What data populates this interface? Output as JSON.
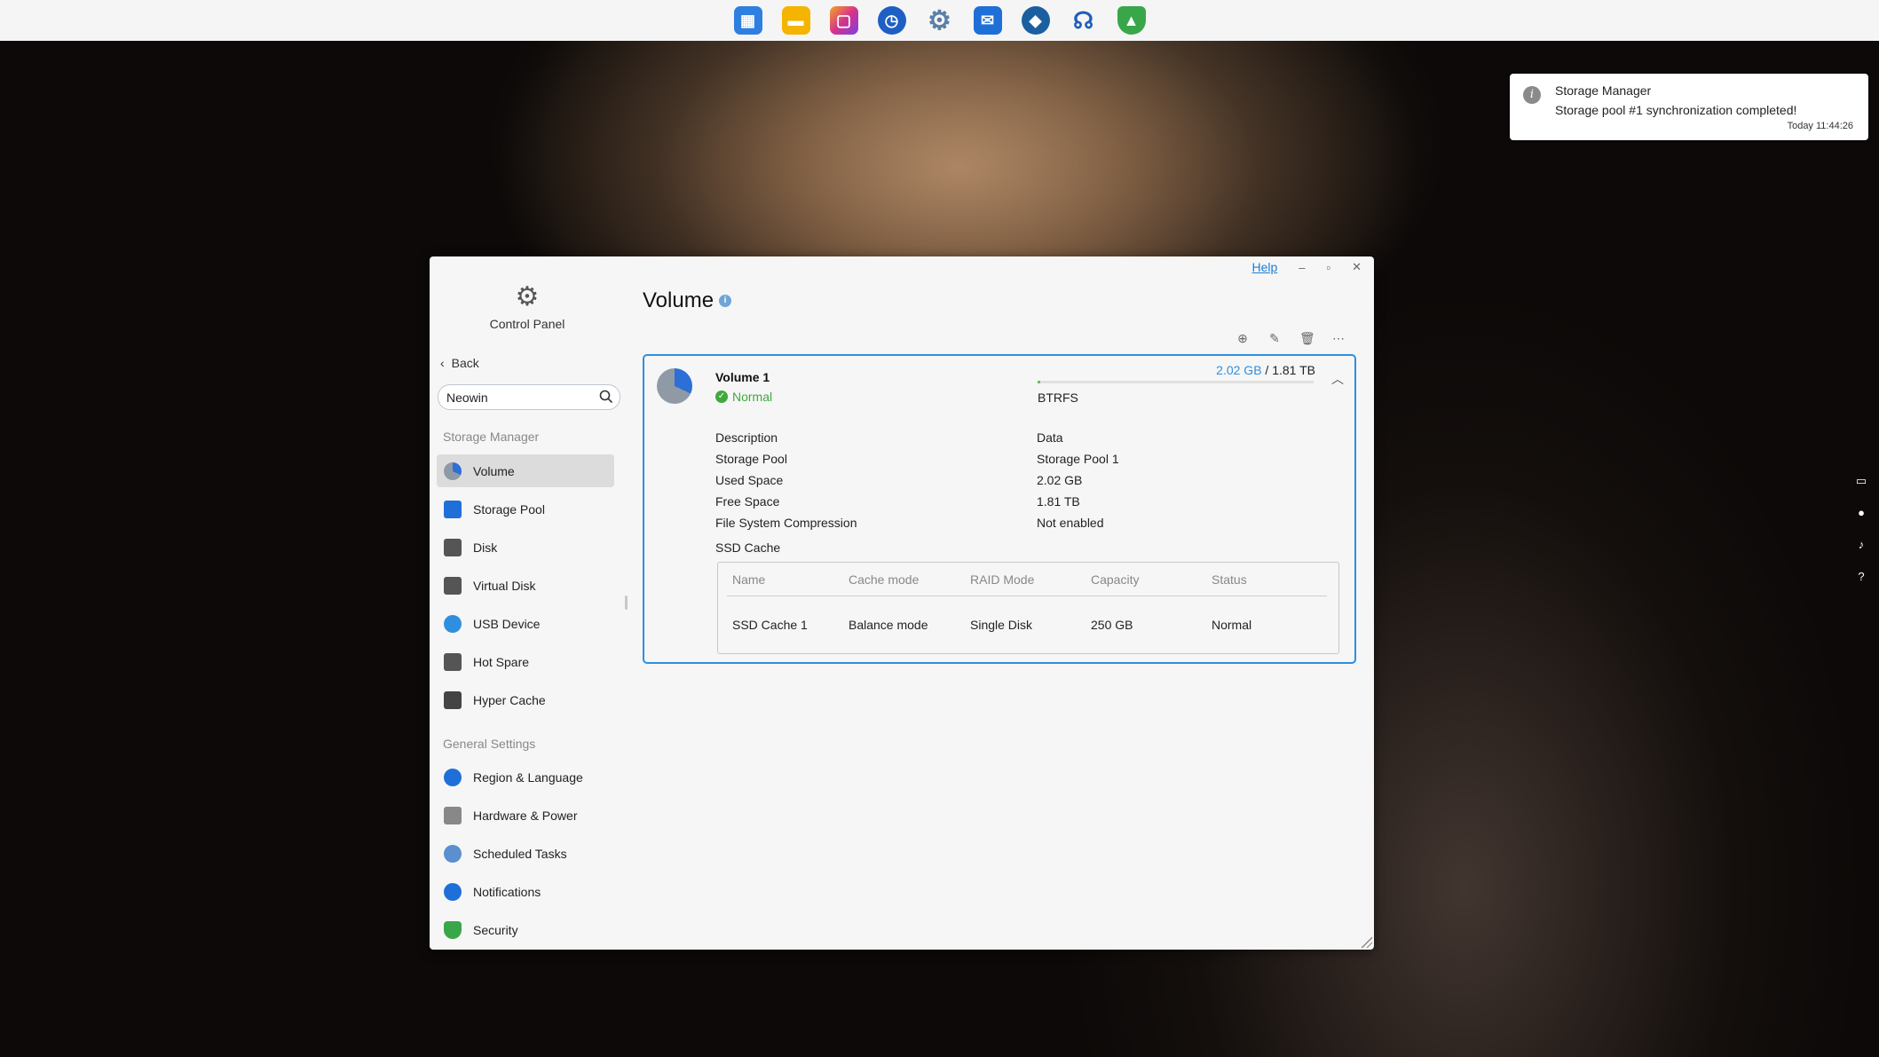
{
  "taskbar": {
    "icons": [
      {
        "name": "apps-grid-icon",
        "color": "#2f7fe0"
      },
      {
        "name": "folder-icon",
        "color": "#f4b400"
      },
      {
        "name": "photos-icon",
        "color": "#d6338a"
      },
      {
        "name": "backup-clock-icon",
        "color": "#1e5fc4"
      },
      {
        "name": "settings-gear-icon",
        "color": "#5a7fa8"
      },
      {
        "name": "mail-icon",
        "color": "#1f6fd8"
      },
      {
        "name": "docker-icon",
        "color": "#1b5fa0"
      },
      {
        "name": "support-headset-icon",
        "color": "#1f5fb8"
      },
      {
        "name": "security-shield-icon",
        "color": "#3aa64a"
      }
    ]
  },
  "toast": {
    "app": "Storage Manager",
    "message": "Storage pool #1 synchronization completed!",
    "time": "Today 11:44:26"
  },
  "window": {
    "help_label": "Help",
    "minimize": "–",
    "maximize": "▫",
    "close": "✕"
  },
  "sidebar": {
    "app_label": "Control Panel",
    "back_label": "Back",
    "search_value": "Neowin",
    "storage_section": "Storage Manager",
    "storage_items": [
      {
        "label": "Volume",
        "color": "#2c6fd6"
      },
      {
        "label": "Storage Pool",
        "color": "#1f6fd8"
      },
      {
        "label": "Disk",
        "color": "#555"
      },
      {
        "label": "Virtual Disk",
        "color": "#555"
      },
      {
        "label": "USB Device",
        "color": "#2f8fde"
      },
      {
        "label": "Hot Spare",
        "color": "#555"
      },
      {
        "label": "Hyper Cache",
        "color": "#444"
      }
    ],
    "general_section": "General Settings",
    "general_items": [
      {
        "label": "Region & Language",
        "color": "#1f6fd8"
      },
      {
        "label": "Hardware & Power",
        "color": "#777"
      },
      {
        "label": "Scheduled Tasks",
        "color": "#5a8fd0"
      },
      {
        "label": "Notifications",
        "color": "#1f6fd8"
      },
      {
        "label": "Security",
        "color": "#3aa64a"
      }
    ]
  },
  "main": {
    "title": "Volume",
    "volume": {
      "name": "Volume 1",
      "status": "Normal",
      "used": "2.02 GB",
      "separator": " / ",
      "total": "1.81 TB",
      "used_fraction": 0.01,
      "filesystem": "BTRFS",
      "properties": [
        {
          "key": "Description",
          "value": "Data"
        },
        {
          "key": "Storage Pool",
          "value": "Storage Pool 1"
        },
        {
          "key": "Used Space",
          "value": "2.02 GB"
        },
        {
          "key": "Free Space",
          "value": "1.81 TB"
        },
        {
          "key": "File System Compression",
          "value": "Not enabled"
        }
      ],
      "ssd_label": "SSD Cache",
      "ssd_headers": [
        "Name",
        "Cache mode",
        "RAID Mode",
        "Capacity",
        "Status"
      ],
      "ssd_row": [
        "SSD Cache 1",
        "Balance mode",
        "Single Disk",
        "250 GB",
        "Normal"
      ]
    }
  }
}
